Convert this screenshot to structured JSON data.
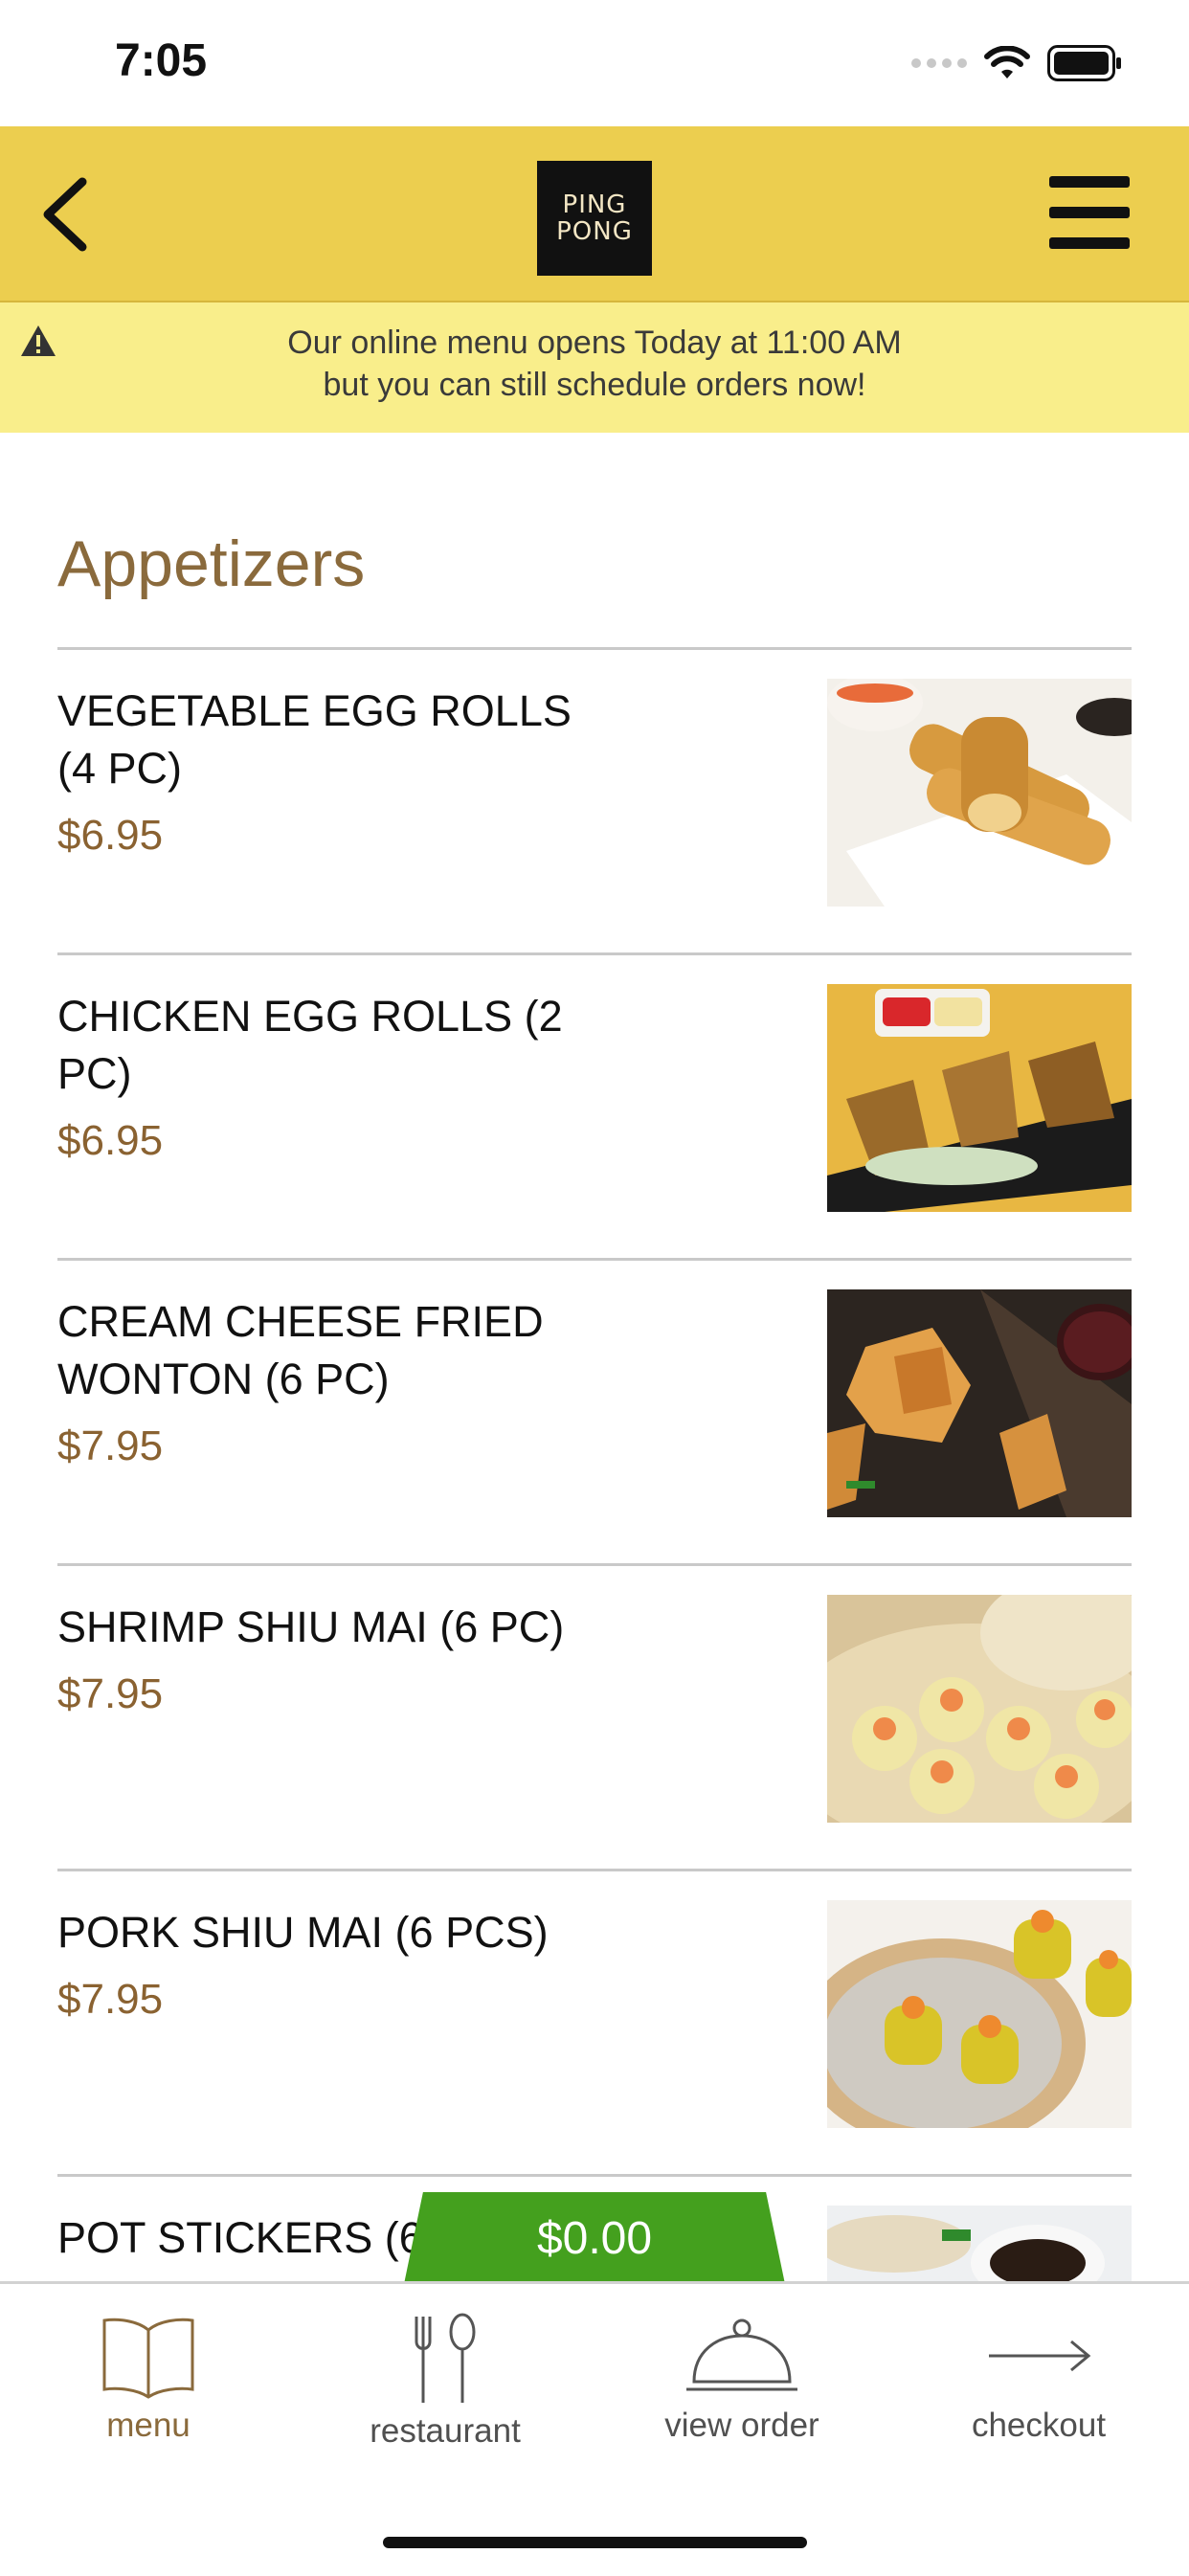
{
  "status": {
    "time": "7:05"
  },
  "header": {
    "logo_line1": "PING",
    "logo_line2": "PONG"
  },
  "banner": {
    "line1": "Our online menu opens Today at 11:00 AM",
    "line2": "but you can still schedule orders now!"
  },
  "section": {
    "title": "Appetizers"
  },
  "items": [
    {
      "name": "VEGETABLE EGG ROLLS (4 PC)",
      "price": "$6.95",
      "photo": "egg-rolls"
    },
    {
      "name": "CHICKEN EGG ROLLS (2 PC)",
      "price": "$6.95",
      "photo": "chicken-rolls"
    },
    {
      "name": "CREAM CHEESE FRIED WONTON (6 PC)",
      "price": "$7.95",
      "photo": "wonton"
    },
    {
      "name": "SHRIMP SHIU MAI (6 PC)",
      "price": "$7.95",
      "photo": "shrimp-shiu-mai"
    },
    {
      "name": "PORK SHIU MAI (6 PCS)",
      "price": "$7.95",
      "photo": "pork-shiu-mai"
    },
    {
      "name": "POT STICKERS (6",
      "price": "",
      "photo": "pot-stickers"
    }
  ],
  "cart": {
    "total": "$0.00"
  },
  "tabs": [
    {
      "label": "menu",
      "icon": "book-icon",
      "active": true
    },
    {
      "label": "restaurant",
      "icon": "fork-spoon-icon",
      "active": false
    },
    {
      "label": "view order",
      "icon": "cloche-icon",
      "active": false
    },
    {
      "label": "checkout",
      "icon": "arrow-right-icon",
      "active": false
    }
  ],
  "colors": {
    "header": "#ecce4f",
    "banner": "#f9ee8b",
    "accent": "#8a6a3c",
    "cart": "#44a01e"
  }
}
